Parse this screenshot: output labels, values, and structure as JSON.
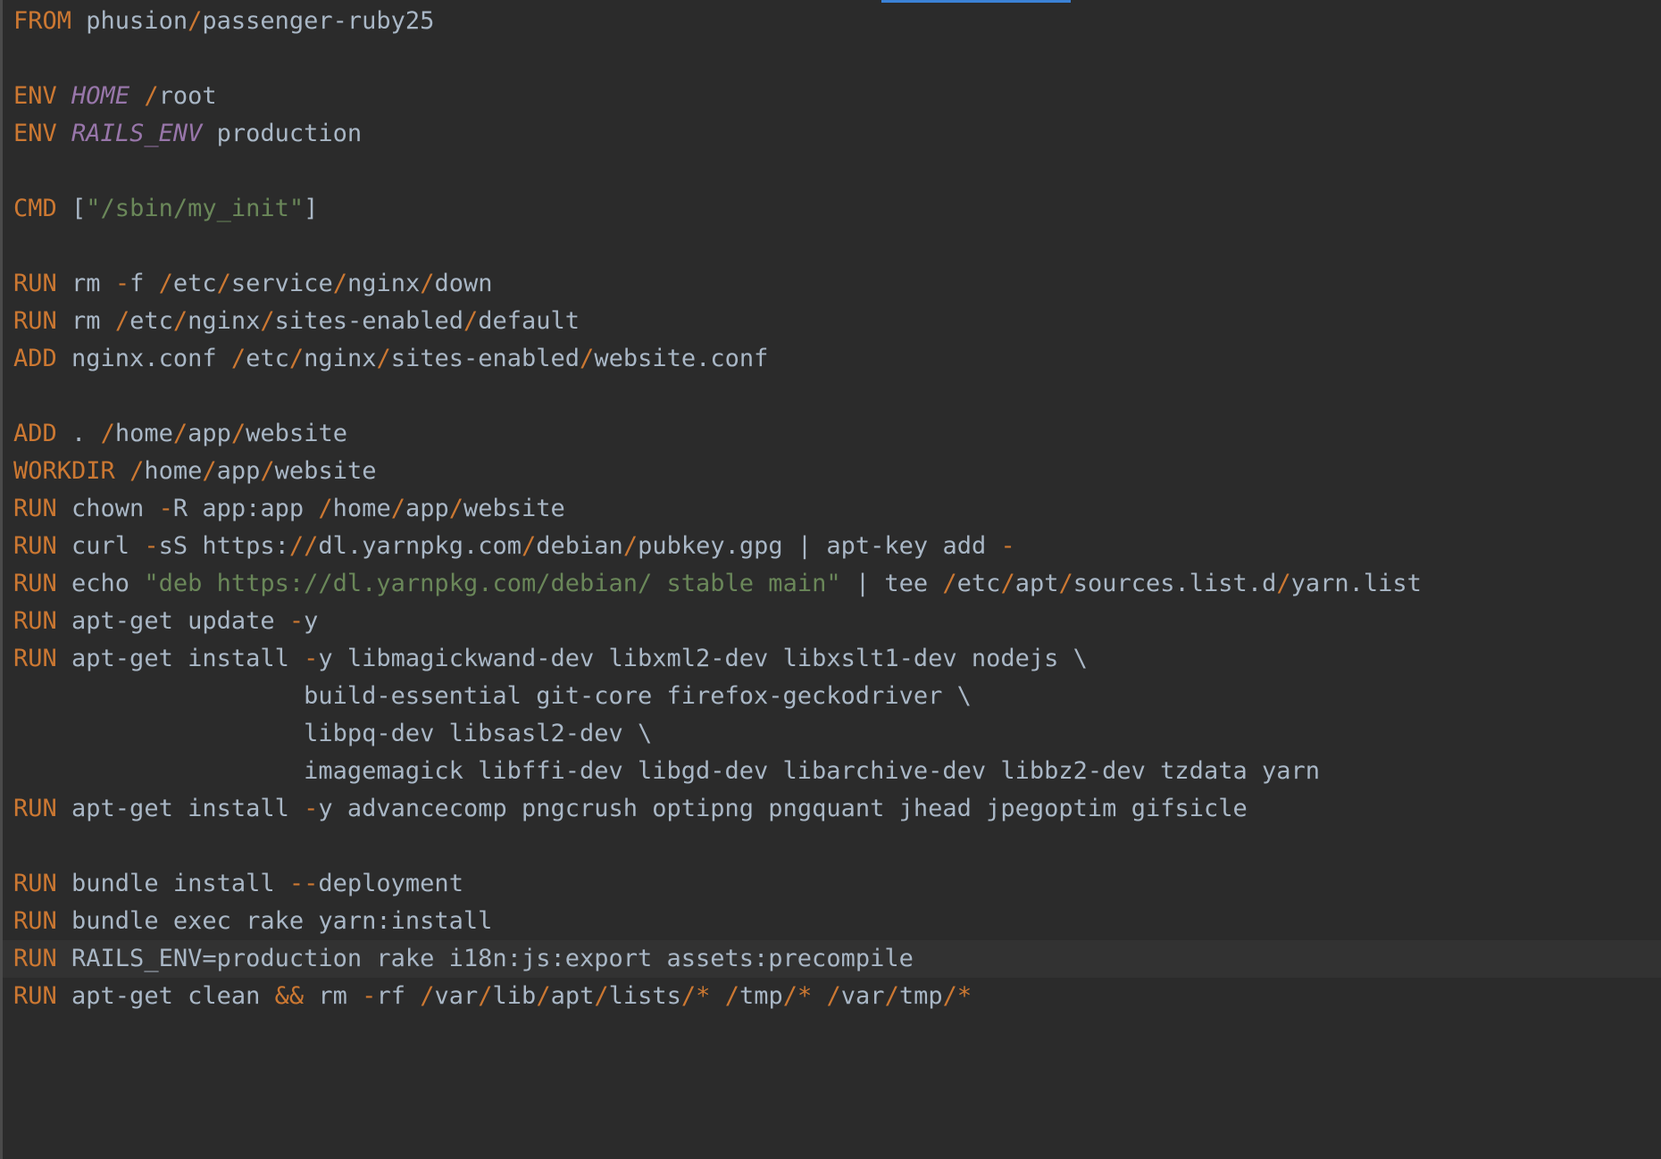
{
  "colors": {
    "background": "#2b2b2b",
    "current_line": "#323232",
    "keyword": "#cc7832",
    "operator": "#cc7832",
    "variable": "#9876aa",
    "string": "#6a8759",
    "text": "#a9b7c6",
    "tab_indicator": "#3b82d6"
  },
  "editor": {
    "current_line_index": 25,
    "lines": [
      [
        [
          "kw",
          "FROM"
        ],
        [
          "p",
          " phusion"
        ],
        [
          "op",
          "/"
        ],
        [
          "p",
          "passenger-ruby25"
        ]
      ],
      [],
      [
        [
          "kw",
          "ENV"
        ],
        [
          "p",
          " "
        ],
        [
          "var",
          "HOME"
        ],
        [
          "p",
          " "
        ],
        [
          "op",
          "/"
        ],
        [
          "p",
          "root"
        ]
      ],
      [
        [
          "kw",
          "ENV"
        ],
        [
          "p",
          " "
        ],
        [
          "var",
          "RAILS_ENV"
        ],
        [
          "p",
          " production"
        ]
      ],
      [],
      [
        [
          "kw",
          "CMD"
        ],
        [
          "p",
          " ["
        ],
        [
          "str",
          "\"/sbin/my_init\""
        ],
        [
          "p",
          "]"
        ]
      ],
      [],
      [
        [
          "kw",
          "RUN"
        ],
        [
          "p",
          " rm "
        ],
        [
          "op",
          "-"
        ],
        [
          "p",
          "f "
        ],
        [
          "op",
          "/"
        ],
        [
          "p",
          "etc"
        ],
        [
          "op",
          "/"
        ],
        [
          "p",
          "service"
        ],
        [
          "op",
          "/"
        ],
        [
          "p",
          "nginx"
        ],
        [
          "op",
          "/"
        ],
        [
          "p",
          "down"
        ]
      ],
      [
        [
          "kw",
          "RUN"
        ],
        [
          "p",
          " rm "
        ],
        [
          "op",
          "/"
        ],
        [
          "p",
          "etc"
        ],
        [
          "op",
          "/"
        ],
        [
          "p",
          "nginx"
        ],
        [
          "op",
          "/"
        ],
        [
          "p",
          "sites-enabled"
        ],
        [
          "op",
          "/"
        ],
        [
          "p",
          "default"
        ]
      ],
      [
        [
          "kw",
          "ADD"
        ],
        [
          "p",
          " nginx.conf "
        ],
        [
          "op",
          "/"
        ],
        [
          "p",
          "etc"
        ],
        [
          "op",
          "/"
        ],
        [
          "p",
          "nginx"
        ],
        [
          "op",
          "/"
        ],
        [
          "p",
          "sites-enabled"
        ],
        [
          "op",
          "/"
        ],
        [
          "p",
          "website.conf"
        ]
      ],
      [],
      [
        [
          "kw",
          "ADD"
        ],
        [
          "p",
          " . "
        ],
        [
          "op",
          "/"
        ],
        [
          "p",
          "home"
        ],
        [
          "op",
          "/"
        ],
        [
          "p",
          "app"
        ],
        [
          "op",
          "/"
        ],
        [
          "p",
          "website"
        ]
      ],
      [
        [
          "kw",
          "WORKDIR"
        ],
        [
          "p",
          " "
        ],
        [
          "op",
          "/"
        ],
        [
          "p",
          "home"
        ],
        [
          "op",
          "/"
        ],
        [
          "p",
          "app"
        ],
        [
          "op",
          "/"
        ],
        [
          "p",
          "website"
        ]
      ],
      [
        [
          "kw",
          "RUN"
        ],
        [
          "p",
          " chown "
        ],
        [
          "op",
          "-"
        ],
        [
          "p",
          "R app:app "
        ],
        [
          "op",
          "/"
        ],
        [
          "p",
          "home"
        ],
        [
          "op",
          "/"
        ],
        [
          "p",
          "app"
        ],
        [
          "op",
          "/"
        ],
        [
          "p",
          "website"
        ]
      ],
      [
        [
          "kw",
          "RUN"
        ],
        [
          "p",
          " curl "
        ],
        [
          "op",
          "-"
        ],
        [
          "p",
          "sS https:"
        ],
        [
          "op",
          "//"
        ],
        [
          "p",
          "dl.yarnpkg.com"
        ],
        [
          "op",
          "/"
        ],
        [
          "p",
          "debian"
        ],
        [
          "op",
          "/"
        ],
        [
          "p",
          "pubkey.gpg | apt-key add "
        ],
        [
          "op",
          "-"
        ]
      ],
      [
        [
          "kw",
          "RUN"
        ],
        [
          "p",
          " echo "
        ],
        [
          "str",
          "\"deb https://dl.yarnpkg.com/debian/ stable main\""
        ],
        [
          "p",
          " | tee "
        ],
        [
          "op",
          "/"
        ],
        [
          "p",
          "etc"
        ],
        [
          "op",
          "/"
        ],
        [
          "p",
          "apt"
        ],
        [
          "op",
          "/"
        ],
        [
          "p",
          "sources.list.d"
        ],
        [
          "op",
          "/"
        ],
        [
          "p",
          "yarn.list"
        ]
      ],
      [
        [
          "kw",
          "RUN"
        ],
        [
          "p",
          " apt-get update "
        ],
        [
          "op",
          "-"
        ],
        [
          "p",
          "y"
        ]
      ],
      [
        [
          "kw",
          "RUN"
        ],
        [
          "p",
          " apt-get install "
        ],
        [
          "op",
          "-"
        ],
        [
          "p",
          "y libmagickwand-dev libxml2-dev libxslt1-dev nodejs \\"
        ]
      ],
      [
        [
          "p",
          "                    build-essential git-core firefox-geckodriver \\"
        ]
      ],
      [
        [
          "p",
          "                    libpq-dev libsasl2-dev \\"
        ]
      ],
      [
        [
          "p",
          "                    imagemagick libffi-dev libgd-dev libarchive-dev libbz2-dev tzdata yarn"
        ]
      ],
      [
        [
          "kw",
          "RUN"
        ],
        [
          "p",
          " apt-get install "
        ],
        [
          "op",
          "-"
        ],
        [
          "p",
          "y advancecomp pngcrush optipng pngquant jhead jpegoptim gifsicle"
        ]
      ],
      [],
      [
        [
          "kw",
          "RUN"
        ],
        [
          "p",
          " bundle install "
        ],
        [
          "op",
          "--"
        ],
        [
          "p",
          "deployment"
        ]
      ],
      [
        [
          "kw",
          "RUN"
        ],
        [
          "p",
          " bundle exec rake yarn:install"
        ]
      ],
      [
        [
          "kw",
          "RUN"
        ],
        [
          "p",
          " RAILS_ENV=production rake i18n:js:export assets:precompile"
        ]
      ],
      [
        [
          "kw",
          "RUN"
        ],
        [
          "p",
          " apt-get clean "
        ],
        [
          "op",
          "&&"
        ],
        [
          "p",
          " rm "
        ],
        [
          "op",
          "-"
        ],
        [
          "p",
          "rf "
        ],
        [
          "op",
          "/"
        ],
        [
          "p",
          "var"
        ],
        [
          "op",
          "/"
        ],
        [
          "p",
          "lib"
        ],
        [
          "op",
          "/"
        ],
        [
          "p",
          "apt"
        ],
        [
          "op",
          "/"
        ],
        [
          "p",
          "lists"
        ],
        [
          "op",
          "/*"
        ],
        [
          "p",
          " "
        ],
        [
          "op",
          "/"
        ],
        [
          "p",
          "tmp"
        ],
        [
          "op",
          "/*"
        ],
        [
          "p",
          " "
        ],
        [
          "op",
          "/"
        ],
        [
          "p",
          "var"
        ],
        [
          "op",
          "/"
        ],
        [
          "p",
          "tmp"
        ],
        [
          "op",
          "/*"
        ]
      ]
    ]
  }
}
